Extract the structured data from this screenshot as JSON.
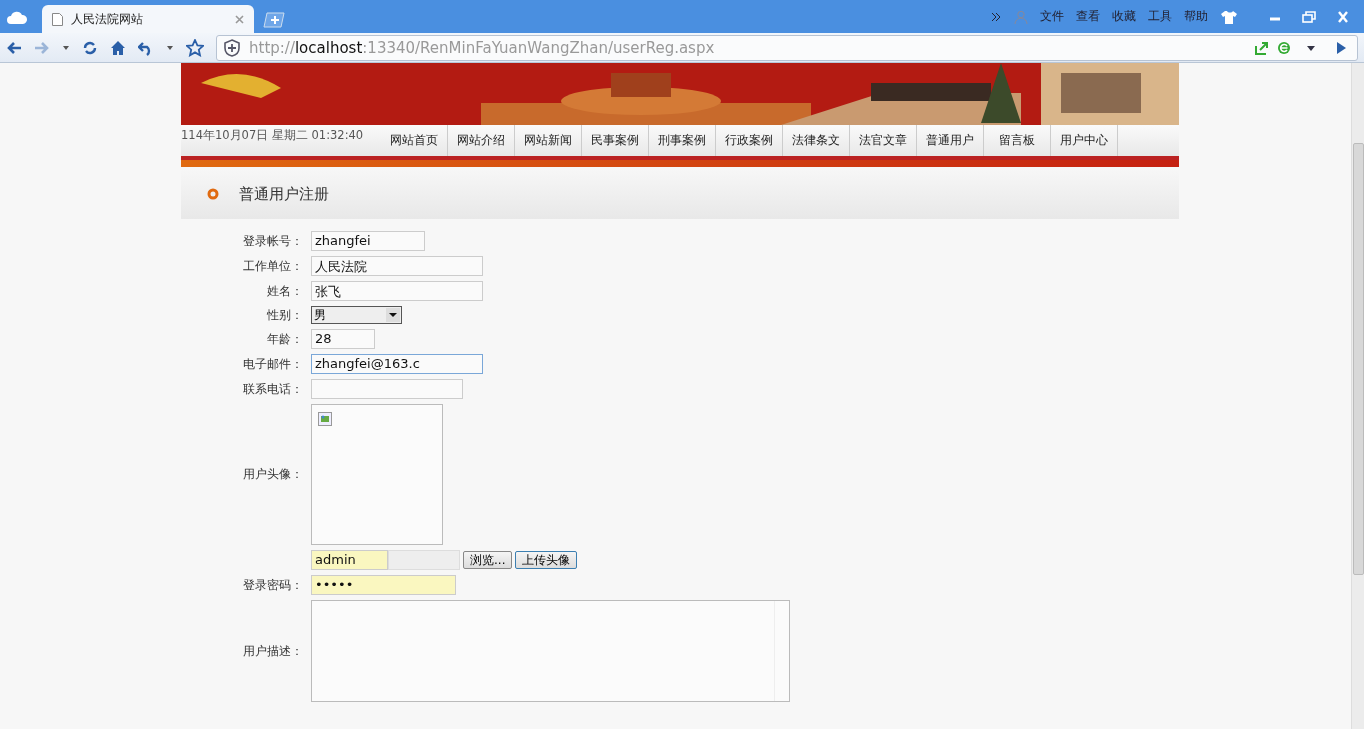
{
  "browser": {
    "tab": {
      "title": "人民法院网站"
    },
    "menu": [
      "文件",
      "查看",
      "收藏",
      "工具",
      "帮助"
    ],
    "address": {
      "scheme": "http://",
      "host": "localhost",
      "rest": ":13340/RenMinFaYuanWangZhan/userReg.aspx"
    }
  },
  "header": {
    "datetime": "114年10月07日 星期二 01:32:40",
    "nav": [
      "网站首页",
      "网站介绍",
      "网站新闻",
      "民事案例",
      "刑事案例",
      "行政案例",
      "法律条文",
      "法官文章",
      "普通用户",
      "留言板",
      "用户中心"
    ]
  },
  "section": {
    "title": "普通用户注册"
  },
  "form": {
    "fields": [
      {
        "kind": "text",
        "label": "登录帐号：",
        "value": "zhangfei",
        "focused": false,
        "autofilled": false
      },
      {
        "kind": "text",
        "label": "工作单位：",
        "value": "人民法院",
        "focused": false,
        "autofilled": false
      },
      {
        "kind": "text",
        "label": "姓名：",
        "value": "张飞",
        "focused": false,
        "autofilled": false
      },
      {
        "kind": "select",
        "label": "性别：",
        "value": "男"
      },
      {
        "kind": "text",
        "label": "年龄：",
        "value": "28",
        "focused": false,
        "autofilled": false
      },
      {
        "kind": "text",
        "label": "电子邮件：",
        "value": "zhangfei@163.c",
        "focused": true,
        "autofilled": false
      },
      {
        "kind": "text",
        "label": "联系电话：",
        "focused": false,
        "autofilled": false
      },
      {
        "kind": "avatar",
        "label": "用户头像："
      },
      {
        "kind": "upload",
        "value": "admin",
        "autofilled": true,
        "browse": "浏览...",
        "button": "上传头像"
      },
      {
        "kind": "password",
        "label": "登录密码：",
        "value": "•••••",
        "autofilled": true
      },
      {
        "kind": "textarea",
        "label": "用户描述："
      }
    ]
  }
}
